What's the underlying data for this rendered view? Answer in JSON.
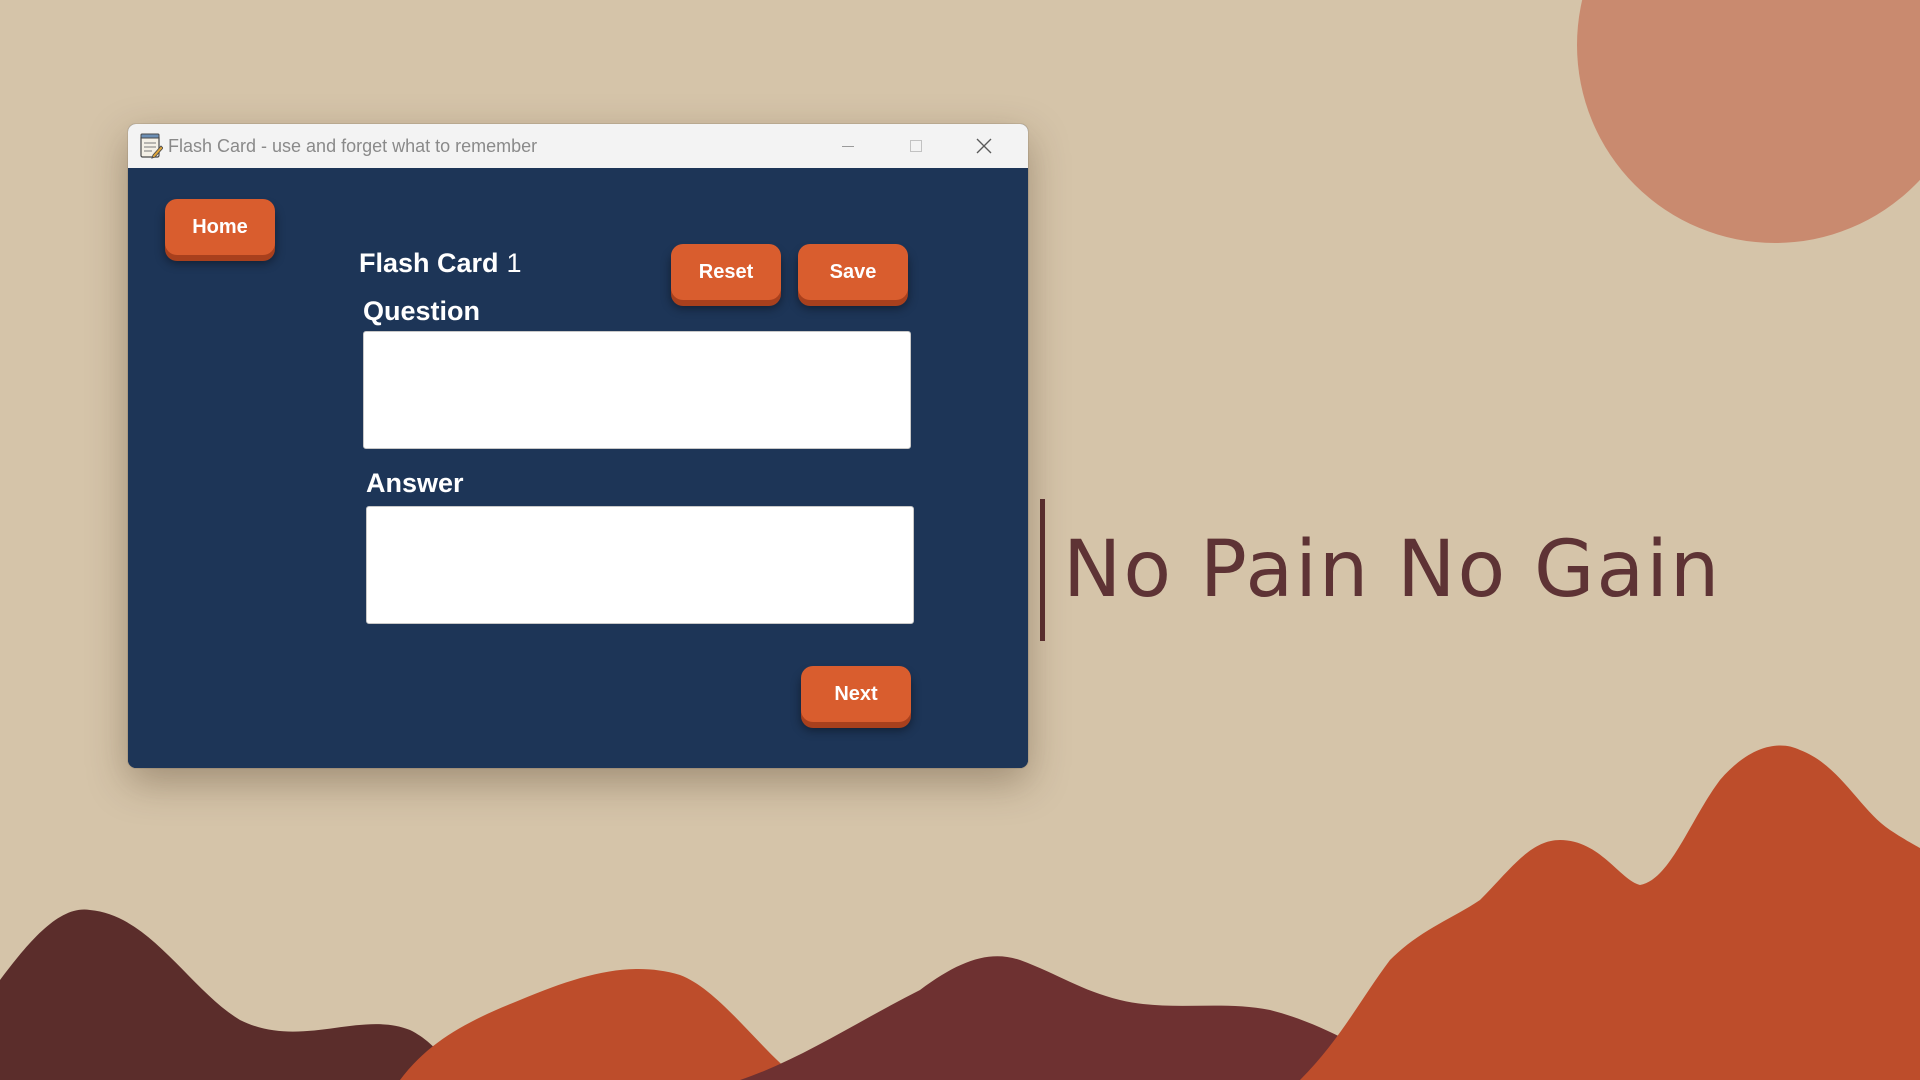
{
  "window": {
    "title": "Flash Card - use and forget what to remember",
    "minimize_label": "Minimize",
    "maximize_label": "Maximize",
    "close_label": "Close"
  },
  "nav": {
    "home_label": "Home"
  },
  "card": {
    "title_label": "Flash Card",
    "number": "1",
    "reset_label": "Reset",
    "save_label": "Save",
    "next_label": "Next"
  },
  "question": {
    "label": "Question",
    "value": ""
  },
  "answer": {
    "label": "Answer",
    "value": ""
  },
  "wallpaper": {
    "tagline": "No Pain No Gain",
    "colors": {
      "background": "#d5c4a9",
      "sun": "#c98a6f",
      "mountain_orange": "#bd4d2b",
      "mountain_dark": "#5b2d2b",
      "mountain_brown": "#6e3131",
      "text": "#5e3335"
    }
  },
  "theme": {
    "window_bg": "#1d3557",
    "button_bg": "#d95d2e",
    "button_shadow": "#a8401d",
    "titlebar_bg": "#f3f3f3"
  }
}
